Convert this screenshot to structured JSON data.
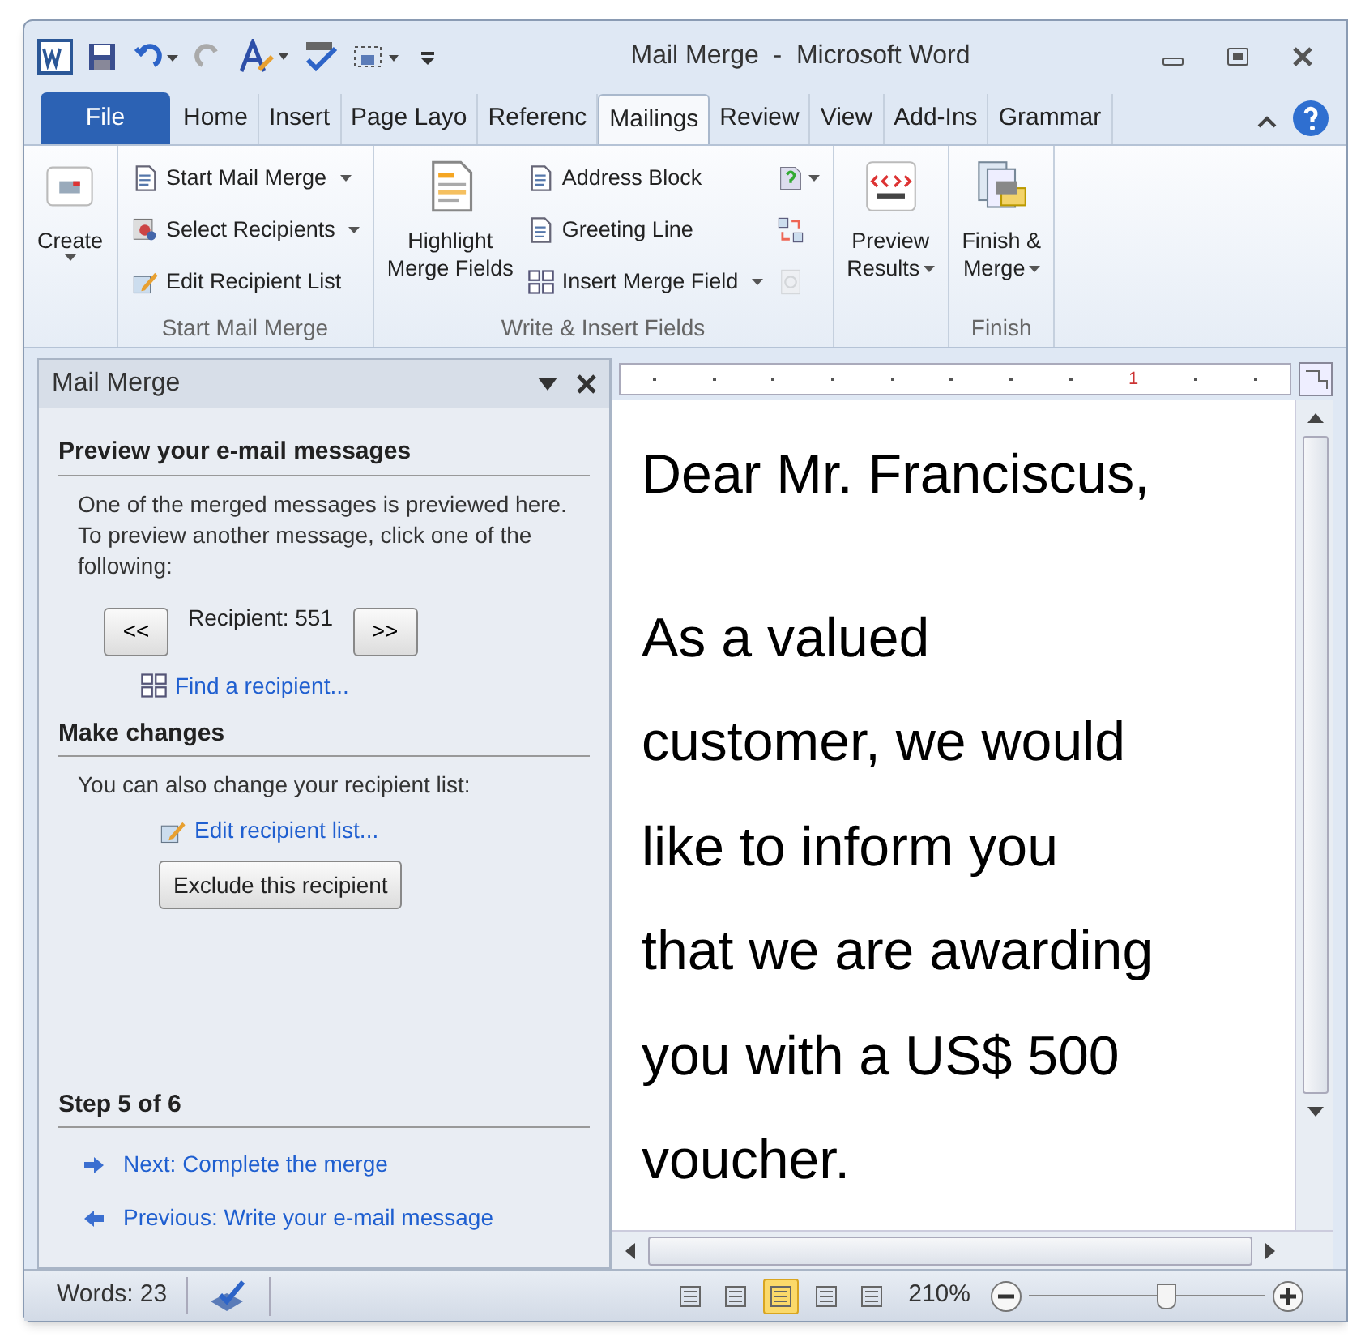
{
  "window": {
    "title": "Mail Merge  -  Microsoft Word"
  },
  "tabs": [
    {
      "label": "File",
      "kind": "file",
      "selected": false
    },
    {
      "label": "Home",
      "kind": "tab",
      "selected": false
    },
    {
      "label": "Insert",
      "kind": "tab",
      "selected": false
    },
    {
      "label": "Page Layo",
      "kind": "tab",
      "selected": false
    },
    {
      "label": "Referenc",
      "kind": "tab",
      "selected": false
    },
    {
      "label": "Mailings",
      "kind": "tab",
      "selected": true
    },
    {
      "label": "Review",
      "kind": "tab",
      "selected": false
    },
    {
      "label": "View",
      "kind": "tab",
      "selected": false
    },
    {
      "label": "Add-Ins",
      "kind": "tab",
      "selected": false
    },
    {
      "label": "Grammar",
      "kind": "tab",
      "selected": false
    }
  ],
  "ribbon_groups": [
    {
      "items": [
        {
          "kind": "large",
          "lines": [
            "Create"
          ],
          "dropdown": true
        }
      ]
    },
    {
      "label": "Start Mail Merge",
      "items": [
        {
          "kind": "column",
          "children": [
            {
              "kind": "small",
              "label": "Start Mail Merge",
              "dropdown": true
            },
            {
              "kind": "small",
              "label": "Select Recipients",
              "dropdown": true
            },
            {
              "kind": "small",
              "label": "Edit Recipient List"
            }
          ]
        }
      ]
    },
    {
      "label": "Write & Insert Fields",
      "items": [
        {
          "kind": "large",
          "lines": [
            "Highlight",
            "Merge Fields"
          ]
        },
        {
          "kind": "column",
          "children": [
            {
              "kind": "small",
              "label": "Address Block"
            },
            {
              "kind": "small",
              "label": "Greeting Line"
            },
            {
              "kind": "small",
              "label": "Insert Merge Field",
              "dropdown": true
            }
          ]
        },
        {
          "kind": "column",
          "children": [
            {
              "kind": "icon",
              "dropdown": true,
              "disabled": false
            },
            {
              "kind": "icon",
              "disabled": false
            },
            {
              "kind": "icon",
              "disabled": true
            }
          ]
        }
      ]
    },
    {
      "items": [
        {
          "kind": "large",
          "lines": [
            "Preview",
            "Results"
          ],
          "dropdown": true
        }
      ]
    },
    {
      "label": "Finish",
      "items": [
        {
          "kind": "large",
          "lines": [
            "Finish &",
            "Merge"
          ],
          "dropdown": true
        }
      ]
    }
  ],
  "task_pane": {
    "title": "Mail Merge",
    "sections": [
      {
        "heading": "Preview your e-mail messages",
        "text": "One of the merged messages is previewed here. To preview another message, click one of the following:",
        "nav": {
          "prev": "<<",
          "recipient": "Recipient: 551",
          "next": ">>"
        },
        "link": "Find a recipient..."
      },
      {
        "heading": "Make changes",
        "text": "You can also change your recipient list:",
        "link": "Edit recipient list...",
        "button": "Exclude this recipient"
      }
    ],
    "step": "Step 5 of 6",
    "step_links": [
      {
        "kind": "next",
        "label": "Next: Complete the merge"
      },
      {
        "kind": "previous",
        "label": "Previous: Write your e-mail message"
      }
    ]
  },
  "ruler": {
    "mark": "1"
  },
  "document": {
    "paragraphs": [
      {
        "lines": [
          "Dear Mr. Franciscus,"
        ]
      },
      {
        "lines": [
          "As a valued",
          "customer, we would",
          "like to inform you",
          "that we are awarding",
          "you with a US$ 500",
          "voucher."
        ]
      }
    ]
  },
  "status_bar": {
    "words": "Words: 23",
    "view_buttons": [
      {
        "selected": false
      },
      {
        "selected": false
      },
      {
        "selected": true
      },
      {
        "selected": false
      },
      {
        "selected": false
      }
    ],
    "zoom": "210%",
    "zoom_level": {
      "level": 0.58
    }
  }
}
